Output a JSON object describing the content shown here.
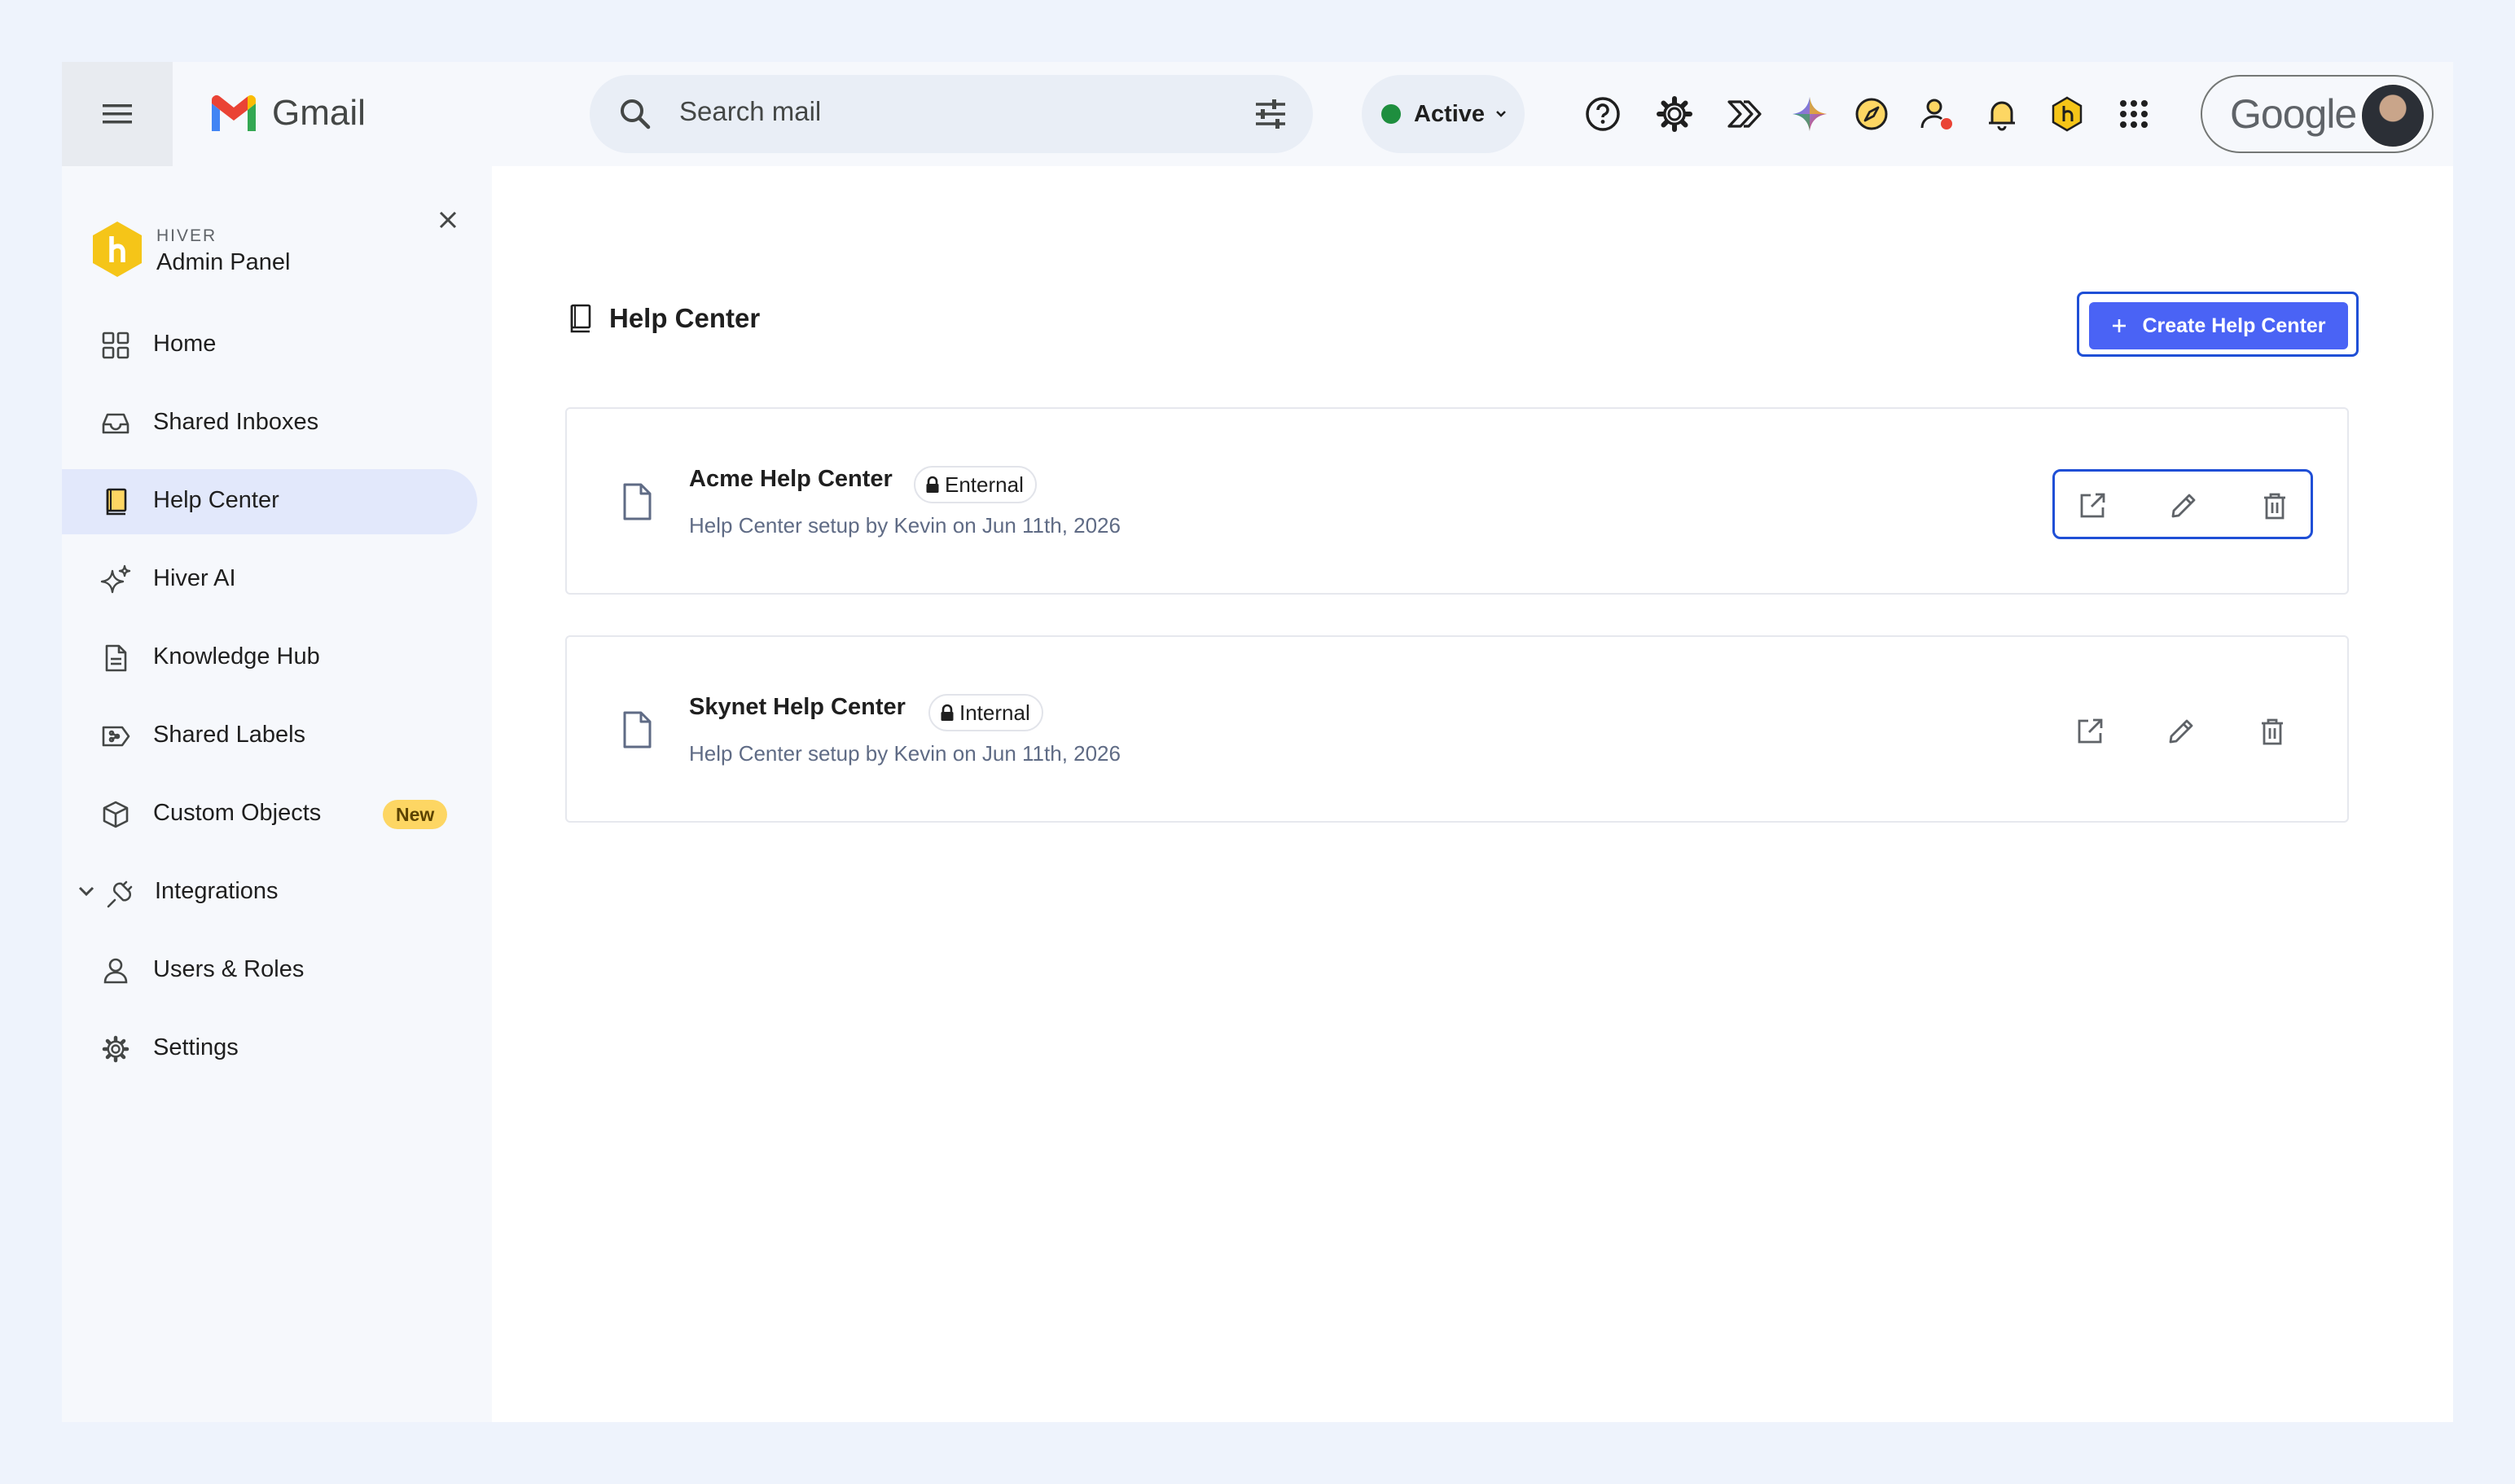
{
  "app": {
    "name": "Gmail"
  },
  "search": {
    "placeholder": "Search mail"
  },
  "status": {
    "label": "Active",
    "color": "#1e8e3e"
  },
  "account": {
    "label": "Google"
  },
  "toolbar_icons": [
    "help-icon",
    "settings-icon",
    "hiver-flow-icon",
    "gemini-icon",
    "compass-icon",
    "user-status-icon",
    "bell-icon",
    "hiver-icon",
    "apps-grid-icon"
  ],
  "sidebar": {
    "brand_small": "HIVER",
    "brand_title": "Admin Panel",
    "items": [
      {
        "label": "Home",
        "icon": "grid-icon"
      },
      {
        "label": "Shared Inboxes",
        "icon": "inbox-icon"
      },
      {
        "label": "Help Center",
        "icon": "book-icon",
        "active": true
      },
      {
        "label": "Hiver AI",
        "icon": "sparkle-icon"
      },
      {
        "label": "Knowledge Hub",
        "icon": "document-icon"
      },
      {
        "label": "Shared Labels",
        "icon": "label-icon"
      },
      {
        "label": "Custom Objects",
        "icon": "cube-icon",
        "badge": "New"
      },
      {
        "label": "Integrations",
        "icon": "plug-icon",
        "expandable": true
      },
      {
        "label": "Users & Roles",
        "icon": "person-icon"
      },
      {
        "label": "Settings",
        "icon": "gear-icon"
      }
    ]
  },
  "main": {
    "title": "Help Center",
    "create_label": "Create Help Center",
    "cards": [
      {
        "name": "Acme Help Center",
        "tag": "Enternal",
        "subtitle": "Help Center setup by Kevin on Jun 11th, 2026"
      },
      {
        "name": "Skynet Help Center",
        "tag": "Internal",
        "subtitle": "Help Center setup by Kevin on Jun 11th, 2026"
      }
    ]
  },
  "colors": {
    "accent": "#4a63f5",
    "focus": "#1f4fd6",
    "active_nav": "#e2e8fb",
    "badge": "#fdd663"
  }
}
